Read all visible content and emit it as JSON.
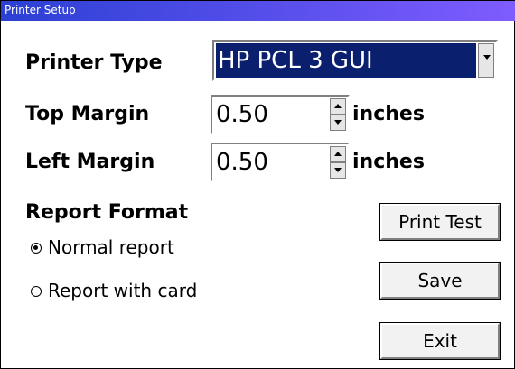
{
  "window": {
    "title": "Printer Setup"
  },
  "printer_type": {
    "label": "Printer Type",
    "selected": "HP PCL 3 GUI"
  },
  "top_margin": {
    "label": "Top Margin",
    "value": "0.50",
    "unit": "inches"
  },
  "left_margin": {
    "label": "Left Margin",
    "value": "0.50",
    "unit": "inches"
  },
  "report_format": {
    "label": "Report Format",
    "options": [
      {
        "label": "Normal report",
        "selected": true
      },
      {
        "label": "Report with card",
        "selected": false
      }
    ]
  },
  "buttons": {
    "print_test": "Print Test",
    "save": "Save",
    "exit": "Exit"
  },
  "colors": {
    "titlebar_start": "#2b40d4",
    "titlebar_end": "#7f5cff",
    "selection": "#0a1f6e"
  }
}
